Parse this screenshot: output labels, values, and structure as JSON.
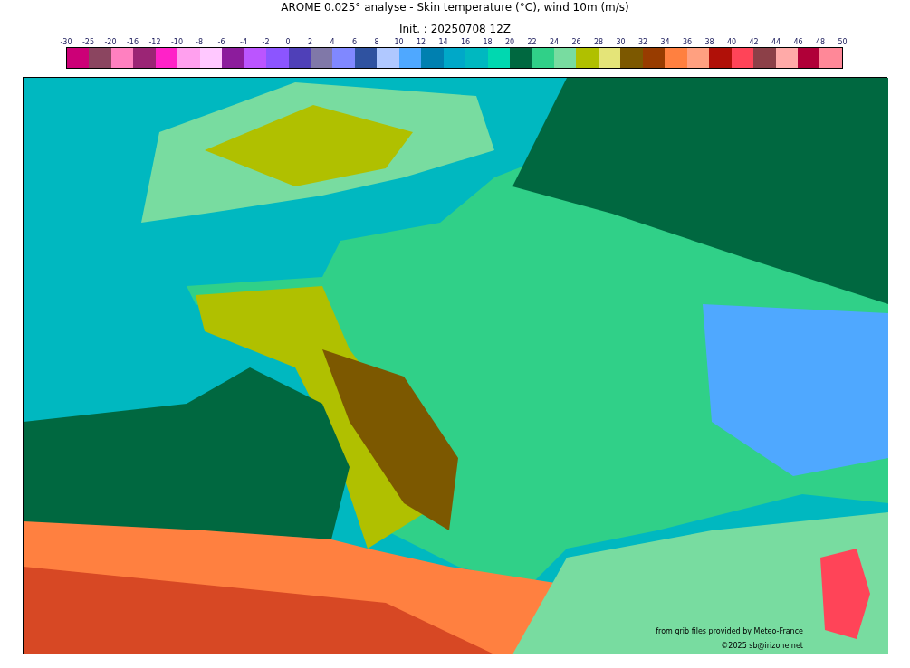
{
  "title": "AROME 0.025° analyse - Skin temperature (°C), wind 10m (m/s)",
  "subtitle": "Init. : 20250708 12Z",
  "colorbar": {
    "ticks": [
      "-30",
      "-25",
      "-20",
      "-16",
      "-12",
      "-10",
      "-8",
      "-6",
      "-4",
      "-2",
      "0",
      "2",
      "4",
      "6",
      "8",
      "10",
      "12",
      "14",
      "16",
      "18",
      "20",
      "22",
      "24",
      "26",
      "28",
      "30",
      "32",
      "34",
      "36",
      "38",
      "40",
      "42",
      "44",
      "46",
      "48",
      "50"
    ],
    "bins": [
      {
        "color": "#cc0077"
      },
      {
        "color": "#8b4560"
      },
      {
        "color": "#ff80c0"
      },
      {
        "color": "#9b2575"
      },
      {
        "color": "#ff22c8"
      },
      {
        "color": "#ffa0ee"
      },
      {
        "color": "#ffc8ff"
      },
      {
        "color": "#8c1c9c"
      },
      {
        "color": "#bb55ff"
      },
      {
        "color": "#8c55ff"
      },
      {
        "color": "#4f40b8"
      },
      {
        "color": "#8078a8"
      },
      {
        "color": "#8088ff"
      },
      {
        "color": "#2f52a0"
      },
      {
        "color": "#b0c8ff"
      },
      {
        "color": "#4fa8ff"
      },
      {
        "color": "#0080b0"
      },
      {
        "color": "#00a8c8"
      },
      {
        "color": "#00b8c0"
      },
      {
        "color": "#00d8b0"
      },
      {
        "color": "#006840"
      },
      {
        "color": "#30d088"
      },
      {
        "color": "#78dca0"
      },
      {
        "color": "#b0c000"
      },
      {
        "color": "#e4e478"
      },
      {
        "color": "#7c5800"
      },
      {
        "color": "#983c00"
      },
      {
        "color": "#ff8040"
      },
      {
        "color": "#ffa080"
      },
      {
        "color": "#b01008"
      },
      {
        "color": "#ff4458"
      },
      {
        "color": "#8c4048"
      },
      {
        "color": "#ffaaa8"
      },
      {
        "color": "#b00038"
      },
      {
        "color": "#ff8898"
      }
    ]
  },
  "map": {
    "credits": [
      "from grib files provided by Meteo-France",
      "©2025 sb@irizone.net"
    ]
  }
}
